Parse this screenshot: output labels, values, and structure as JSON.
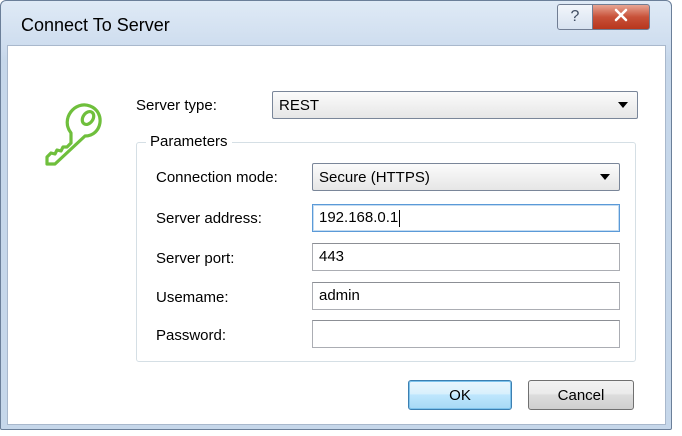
{
  "window": {
    "title": "Connect To Server",
    "help_label": "?",
    "close_label": "x"
  },
  "form": {
    "server_type_label": "Server type:",
    "server_type_value": "REST",
    "parameters_label": "Parameters",
    "connection_mode_label": "Connection mode:",
    "connection_mode_value": "Secure (HTTPS)",
    "server_address_label": "Server address:",
    "server_address_value": "192.168.0.1",
    "server_port_label": "Server port:",
    "server_port_value": "443",
    "username_label": "Usemame:",
    "username_value": "admin",
    "password_label": "Password:",
    "password_value": ""
  },
  "buttons": {
    "ok_label": "OK",
    "cancel_label": "Cancel"
  },
  "icons": {
    "app_icon": "key-icon",
    "help": "question-mark-icon",
    "close": "close-icon",
    "dropdown": "chevron-down-icon"
  },
  "colors": {
    "key_icon": "#6fbf3c",
    "close_button": "#c85139",
    "default_button_border": "#3c7fb1"
  }
}
